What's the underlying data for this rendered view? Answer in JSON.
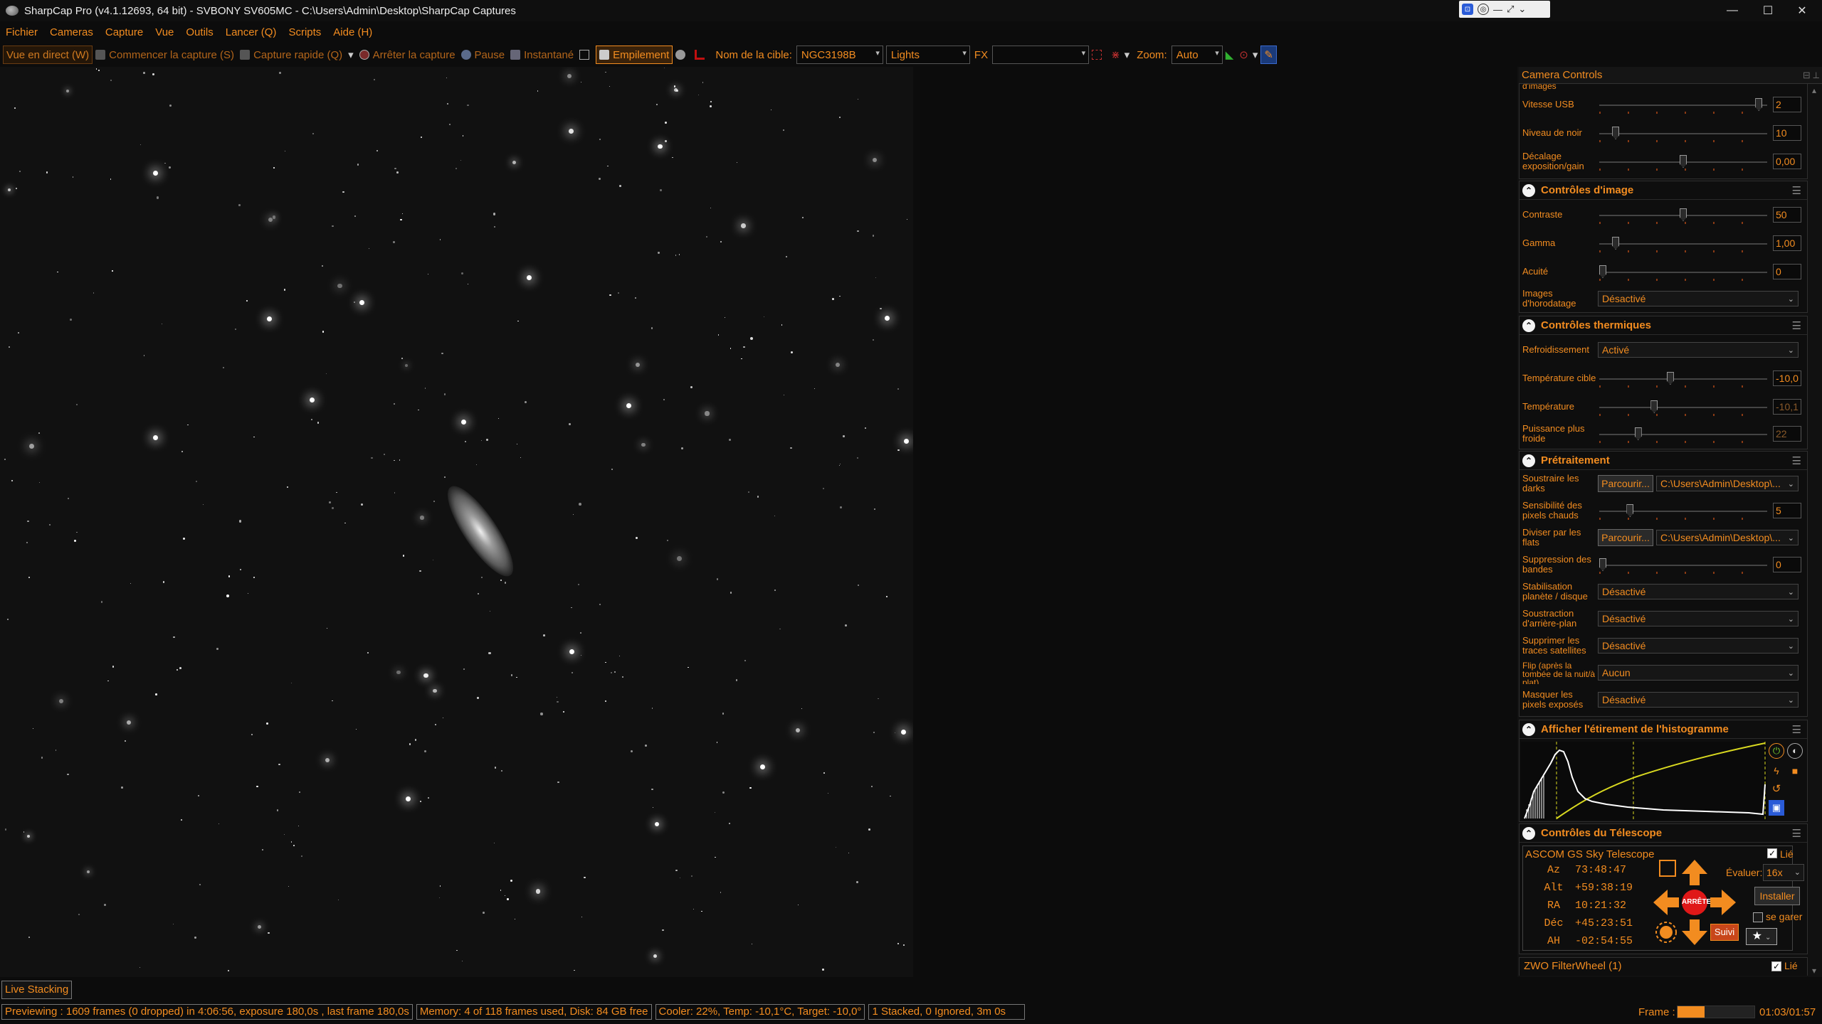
{
  "window": {
    "title": "SharpCap Pro (v4.1.12693, 64 bit) - SVBONY SV605MC - C:\\Users\\Admin\\Desktop\\SharpCap Captures",
    "minimize": "—",
    "maximize": "☐",
    "close": "✕"
  },
  "menu": [
    "Fichier",
    "Cameras",
    "Capture",
    "Vue",
    "Outils",
    "Lancer (Q)",
    "Scripts",
    "Aide (H)"
  ],
  "toolbar": {
    "live_view": "Vue en direct (W)",
    "start_capture": "Commencer la capture (S)",
    "quick_capture": "Capture rapide (Q)",
    "stop_capture": "Arrêter la capture",
    "pause": "Pause",
    "snapshot": "Instantané",
    "stacking": "Empilement",
    "target_label": "Nom de la cible:",
    "target_value": "NGC3198B",
    "frame_type": "Lights",
    "fx_label": "FX",
    "fx_value": "",
    "zoom_label": "Zoom:",
    "zoom_value": "Auto"
  },
  "panel": {
    "title": "Camera Controls",
    "pin": "⊟ ⟂",
    "truncated_label": "d'images",
    "rows_top": [
      {
        "label": "Vitesse USB",
        "value": "2",
        "level": 0.97
      },
      {
        "label": "Niveau de noir",
        "value": "10",
        "level": 0.08
      },
      {
        "label": "Décalage exposition/gain",
        "value": "0,00",
        "level": 0.5
      }
    ],
    "image_controls": {
      "title": "Contrôles d'image",
      "rows": [
        {
          "label": "Contraste",
          "value": "50",
          "level": 0.5
        },
        {
          "label": "Gamma",
          "value": "1,00",
          "level": 0.08
        },
        {
          "label": "Acuité",
          "value": "0",
          "level": 0.0
        }
      ],
      "timestamp": {
        "label": "Images d'horodatage",
        "value": "Désactivé"
      }
    },
    "thermal": {
      "title": "Contrôles thermiques",
      "cooling": {
        "label": "Refroidissement",
        "value": "Activé"
      },
      "rows": [
        {
          "label": "Température cible",
          "value": "-10,0",
          "level": 0.42
        },
        {
          "label": "Température",
          "value": "-10,1",
          "level": 0.32
        },
        {
          "label": "Puissance plus froide",
          "value": "22",
          "level": 0.22
        }
      ]
    },
    "preprocessing": {
      "title": "Prétraitement",
      "darks": {
        "label": "Soustraire les darks",
        "button": "Parcourir...",
        "path": "C:\\Users\\Admin\\Desktop\\..."
      },
      "hotpixels": {
        "label": "Sensibilité des pixels chauds",
        "value": "5",
        "level": 0.17
      },
      "flats": {
        "label": "Diviser par les flats",
        "button": "Parcourir...",
        "path": "C:\\Users\\Admin\\Desktop\\..."
      },
      "banding": {
        "label": "Suppression des bandes",
        "value": "0",
        "level": 0.0
      },
      "dropdowns": [
        {
          "label": "Stabilisation planète / disque",
          "value": "Désactivé"
        },
        {
          "label": "Soustraction d'arrière-plan",
          "value": "Désactivé"
        },
        {
          "label": "Supprimer les traces satellites",
          "value": "Désactivé"
        },
        {
          "label": "Flip (après la tombée de la nuit/à plat)",
          "value": "Aucun"
        },
        {
          "label": "Masquer les pixels exposés",
          "value": "Désactivé"
        }
      ]
    },
    "histogram": {
      "title": "Afficher l'étirement de l'histogramme"
    },
    "telescope": {
      "title": "Contrôles du Télescope",
      "device": "ASCOM GS Sky Telescope",
      "linked": "Lié",
      "rate_label": "Évaluer:",
      "rate_value": "16x",
      "coords": [
        {
          "label": "Az",
          "value": "73:48:47"
        },
        {
          "label": "Alt",
          "value": "+59:38:19"
        },
        {
          "label": "RA",
          "value": "10:21:32"
        },
        {
          "label": "Déc",
          "value": "+45:23:51"
        },
        {
          "label": "AH",
          "value": "-02:54:55"
        }
      ],
      "stop": "ARRÊTE",
      "install": "Installer",
      "park": "se garer",
      "track": "Suivi"
    },
    "filterwheel": {
      "label": "ZWO FilterWheel (1)",
      "linked": "Lié"
    }
  },
  "bottom_tab": "Live Stacking",
  "status": {
    "preview": "Previewing : 1609 frames (0 dropped) in 4:06:56, exposure 180,0s , last frame 180,0s",
    "memory": "Memory: 4 of 118 frames used, Disk: 84 GB free",
    "cooler": "Cooler: 22%, Temp: -10,1°C, Target: -10,0°",
    "stacked": "1 Stacked, 0 Ignored, 3m 0s",
    "frame_label": "Frame :",
    "frame_progress": 0.35,
    "time": "01:03/01:57"
  },
  "colors": {
    "accent": "#f28c20",
    "bg": "#0c0c0c",
    "curve": "#d8d820"
  }
}
